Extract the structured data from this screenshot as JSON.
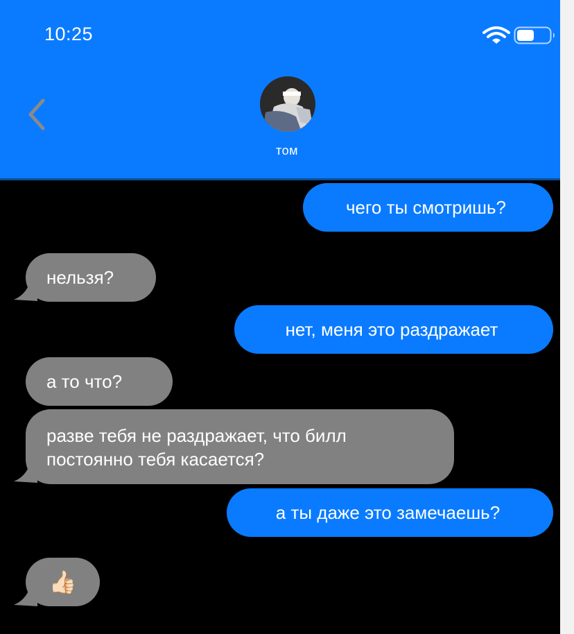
{
  "status_bar": {
    "time": "10:25",
    "icons": [
      "wifi-icon",
      "battery-icon"
    ]
  },
  "header": {
    "contact_name": "том",
    "back_icon": "chevron-left-icon",
    "avatar": "contact-avatar-photo"
  },
  "colors": {
    "header_bg": "#0a7bff",
    "outgoing_bubble": "#0a7bff",
    "incoming_bubble": "#818181",
    "chat_bg": "#000000"
  },
  "messages": [
    {
      "direction": "outgoing",
      "text": "чего ты смотришь?"
    },
    {
      "direction": "incoming",
      "text": "нельзя?"
    },
    {
      "direction": "outgoing",
      "text": "нет, меня это раздражает"
    },
    {
      "direction": "incoming",
      "text": "а то что?"
    },
    {
      "direction": "incoming",
      "lines": [
        "разве тебя не раздражает, что билл",
        "постоянно тебя касается?"
      ]
    },
    {
      "direction": "outgoing",
      "text": "а ты даже это замечаешь?"
    },
    {
      "direction": "incoming",
      "text": "👍🏻"
    }
  ]
}
